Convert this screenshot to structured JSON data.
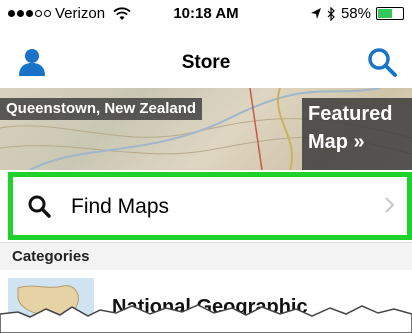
{
  "status_bar": {
    "carrier": "Verizon",
    "time": "10:18 AM",
    "battery": "58%",
    "battery_level": 0.58
  },
  "nav": {
    "title": "Store",
    "left_icon": "user-icon",
    "right_icon": "search-icon"
  },
  "banner": {
    "location": "Queenstown, New Zealand",
    "featured_line1": "Featured",
    "featured_line2": "Map »"
  },
  "find_maps": {
    "label": "Find Maps",
    "icon": "search-icon",
    "chevron": "chevron-right-icon",
    "highlight_color": "#1ed22c"
  },
  "categories": {
    "header": "Categories",
    "first_item": "National Geographic"
  },
  "colors": {
    "accent": "#1a73c9"
  }
}
